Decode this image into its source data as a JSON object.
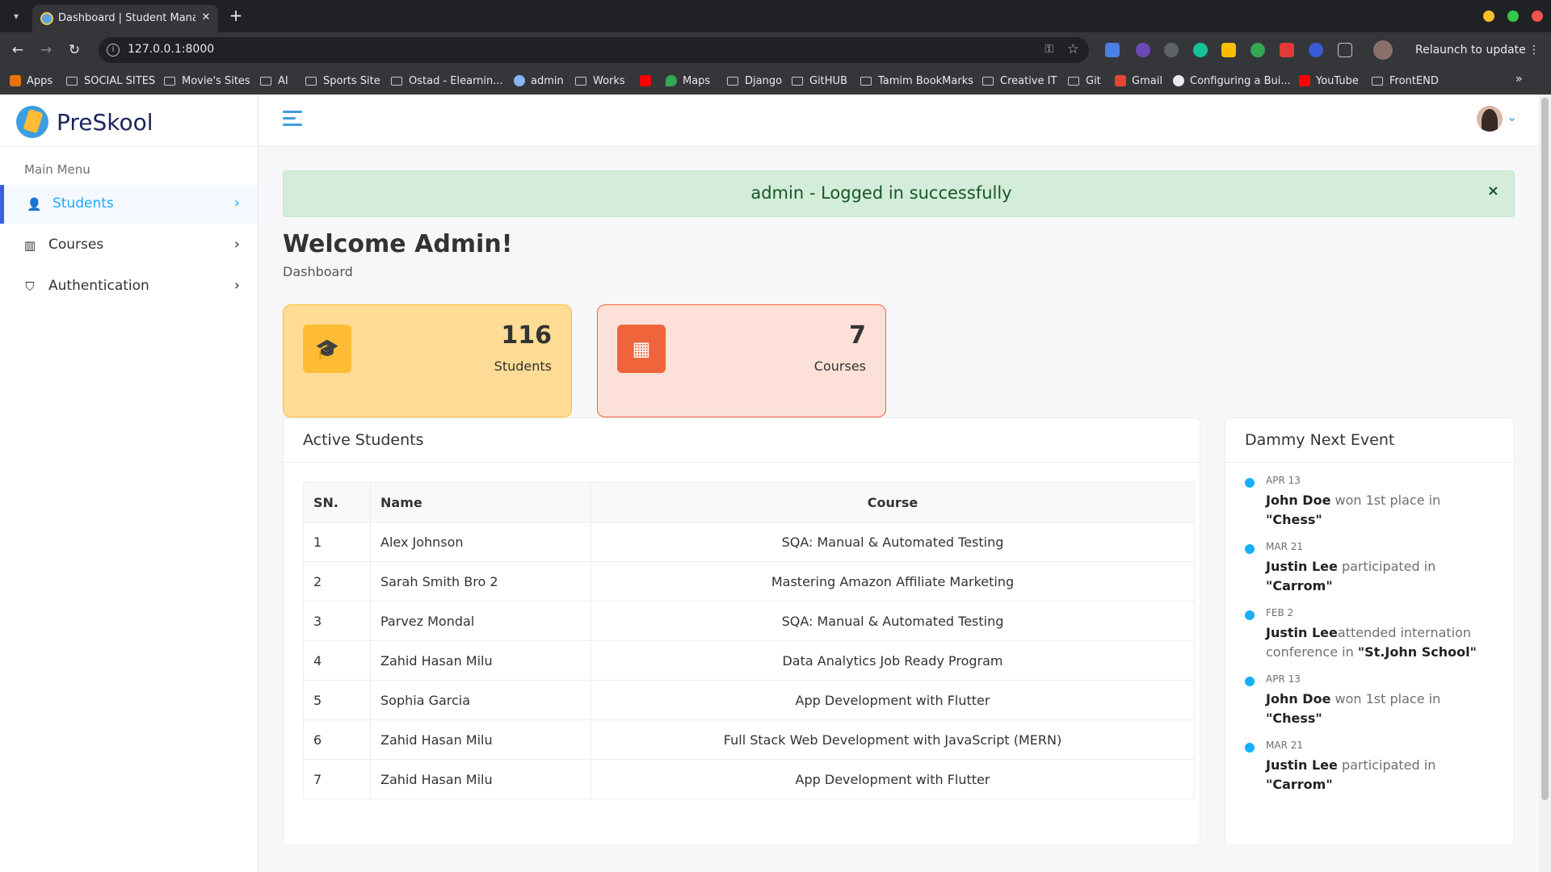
{
  "browser": {
    "tab_title": "Dashboard | Student Management",
    "url": "127.0.0.1:8000",
    "relaunch_label": "Relaunch to update",
    "bookmarks": [
      "Apps",
      "SOCIAL SITES",
      "Movie's Sites",
      "AI",
      "Sports Site",
      "Ostad - Elearnin...",
      "admin",
      "Works",
      "Maps",
      "Django",
      "GitHUB",
      "Tamim BookMarks",
      "Creative IT",
      "Git",
      "Gmail",
      "Configuring a Bui...",
      "YouTube",
      "FrontEND"
    ]
  },
  "sidebar": {
    "logo_text": "PreSkool",
    "menu_title": "Main Menu",
    "items": [
      {
        "label": "Students",
        "icon": "graduation-icon",
        "chevron": "›"
      },
      {
        "label": "Courses",
        "icon": "building-icon",
        "chevron": "›"
      },
      {
        "label": "Authentication",
        "icon": "shield-icon",
        "chevron": "›"
      }
    ]
  },
  "alert": {
    "message": "admin - Logged in successfully",
    "close": "×"
  },
  "page": {
    "title": "Welcome Admin!",
    "breadcrumb": "Dashboard"
  },
  "stats": [
    {
      "value": "116",
      "label": "Students",
      "icon": "student-icon",
      "icon_glyph": "🎓",
      "color": "#ffbc34"
    },
    {
      "value": "7",
      "label": "Courses",
      "icon": "building-icon",
      "icon_glyph": "▦",
      "color": "#f0643c"
    }
  ],
  "active_students": {
    "title": "Active Students",
    "headers": [
      "SN.",
      "Name",
      "Course"
    ],
    "rows": [
      [
        "1",
        "Alex Johnson",
        "SQA: Manual & Automated Testing"
      ],
      [
        "2",
        "Sarah Smith Bro 2",
        "Mastering Amazon Affiliate Marketing"
      ],
      [
        "3",
        "Parvez Mondal",
        "SQA: Manual & Automated Testing"
      ],
      [
        "4",
        "Zahid Hasan Milu",
        "Data Analytics Job Ready Program"
      ],
      [
        "5",
        "Sophia Garcia",
        "App Development with Flutter"
      ],
      [
        "6",
        "Zahid Hasan Milu",
        "Full Stack Web Development with JavaScript (MERN)"
      ],
      [
        "7",
        "Zahid Hasan Milu",
        "App Development with Flutter"
      ]
    ]
  },
  "events": {
    "title": "Dammy Next Event",
    "items": [
      {
        "date": "APR 13",
        "name": "John Doe",
        "text": " won 1st place in ",
        "target": "\"Chess\""
      },
      {
        "date": "MAR 21",
        "name": "Justin Lee",
        "text": " participated in ",
        "target": "\"Carrom\""
      },
      {
        "date": "FEB 2",
        "name": "Justin Lee",
        "text": "attended internation conference in ",
        "target": "\"St.John School\""
      },
      {
        "date": "APR 13",
        "name": "John Doe",
        "text": " won 1st place in ",
        "target": "\"Chess\""
      },
      {
        "date": "MAR 21",
        "name": "Justin Lee",
        "text": " participated in ",
        "target": "\"Carrom\""
      }
    ]
  }
}
